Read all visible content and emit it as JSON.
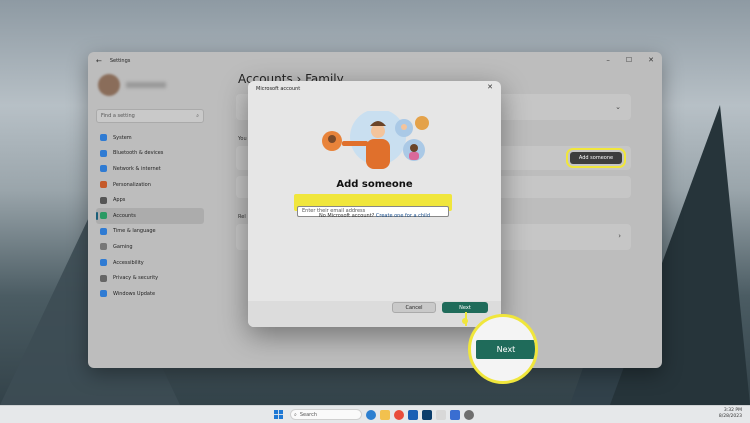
{
  "settings": {
    "title": "Settings",
    "search_placeholder": "Find a setting",
    "page_title": "Accounts  ›  Family",
    "nav": [
      {
        "label": "System",
        "color": "#2f7bd3"
      },
      {
        "label": "Bluetooth & devices",
        "color": "#2f7bd3"
      },
      {
        "label": "Network & internet",
        "color": "#2f7bd3"
      },
      {
        "label": "Personalization",
        "color": "#c55a2a"
      },
      {
        "label": "Apps",
        "color": "#555"
      },
      {
        "label": "Accounts",
        "color": "#2a9a64"
      },
      {
        "label": "Time & language",
        "color": "#2f7bd3"
      },
      {
        "label": "Gaming",
        "color": "#777"
      },
      {
        "label": "Accessibility",
        "color": "#2f7bd3"
      },
      {
        "label": "Privacy & security",
        "color": "#666"
      },
      {
        "label": "Windows Update",
        "color": "#2f7bd3"
      }
    ],
    "add_someone_label": "Add someone"
  },
  "dialog": {
    "title": "Microsoft account",
    "heading": "Add someone",
    "email_placeholder": "Enter their email address",
    "no_account_text": "No Microsoft account?",
    "create_child_link": "Create one for a child",
    "cancel_label": "Cancel",
    "next_label": "Next"
  },
  "callout": {
    "label": "Next"
  },
  "taskbar": {
    "search_label": "Search",
    "time": "3:32 PM",
    "date": "8/28/2023"
  },
  "colors": {
    "highlight": "#f0e63c",
    "primary_button": "#1f6b5a"
  }
}
